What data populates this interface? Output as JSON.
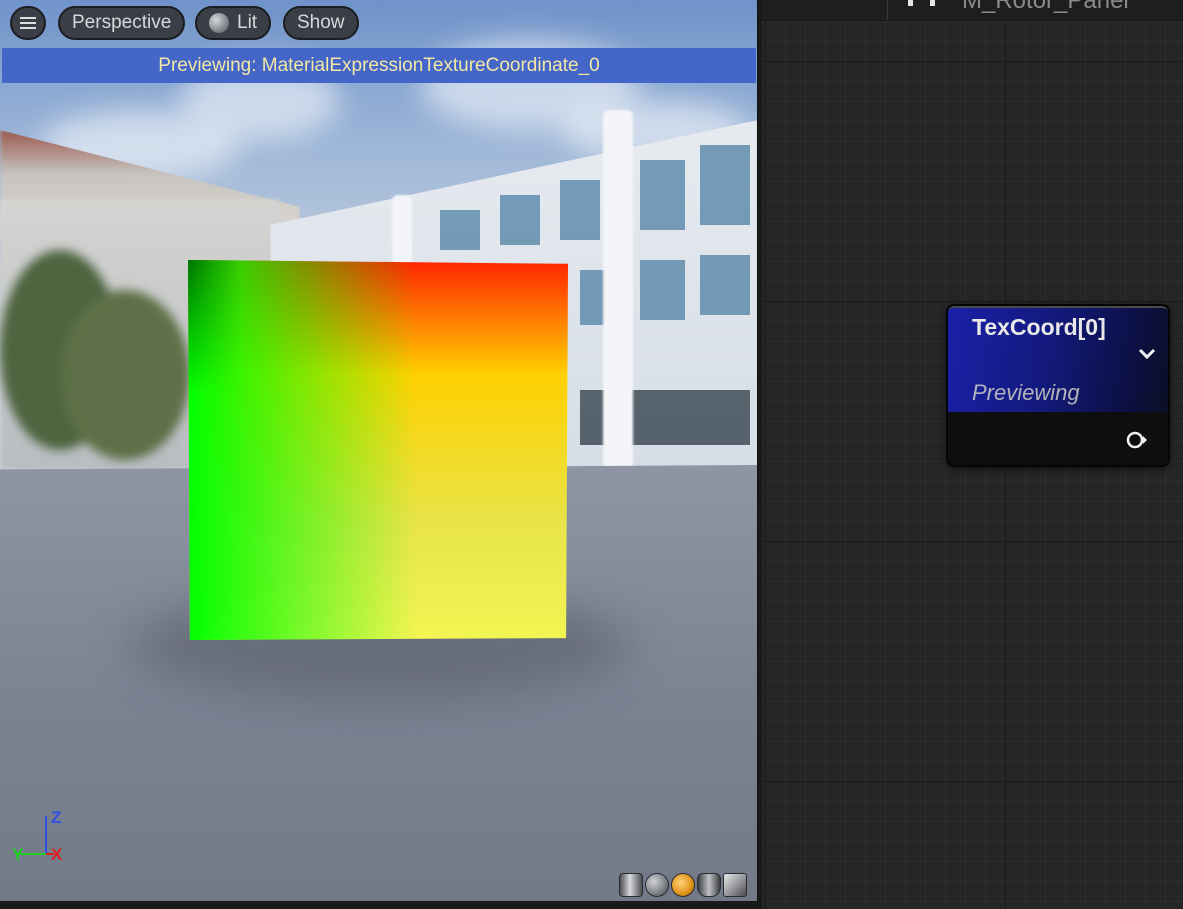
{
  "viewport": {
    "toolbar": {
      "perspective_label": "Perspective",
      "lit_label": "Lit",
      "show_label": "Show"
    },
    "banner": "Previewing: MaterialExpressionTextureCoordinate_0",
    "axis": {
      "x": "X",
      "y": "Y",
      "z": "Z"
    },
    "preview_shapes": [
      "cylinder",
      "sphere",
      "plane",
      "cube",
      "custom-mesh"
    ],
    "active_preview_shape": "plane"
  },
  "graph": {
    "title": "M_Rotor_Panel",
    "node": {
      "title": "TexCoord[0]",
      "subtitle": "Previewing",
      "header_color": "#1a20a8"
    }
  },
  "colors": {
    "banner_bg": "#4466c8",
    "banner_text": "#f2e7a4",
    "axis_x": "#e02020",
    "axis_y": "#20d020",
    "axis_z": "#3050e0"
  }
}
